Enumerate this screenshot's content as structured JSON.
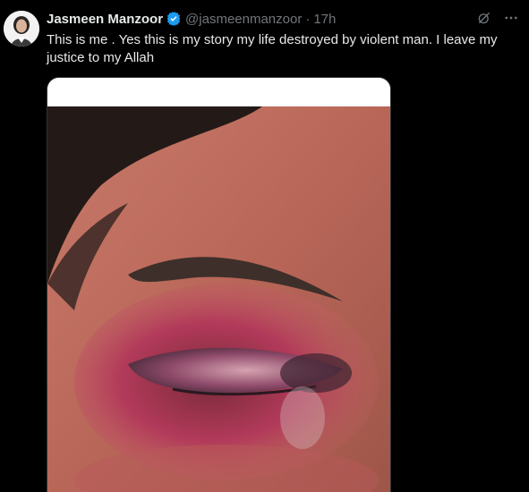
{
  "tweet": {
    "display_name": "Jasmeen Manzoor",
    "handle": "@jasmeenmanzoor",
    "separator": "·",
    "time": "17h",
    "text": "This is me . Yes this is my story my life destroyed by violent man. I leave my justice to my Allah"
  },
  "icons": {
    "verified": "verified-badge-icon",
    "grok": "grok-icon",
    "more": "more-icon"
  },
  "colors": {
    "background": "#000000",
    "text_primary": "#e7e9ea",
    "text_secondary": "#71767b",
    "verified_blue": "#1d9bf0"
  }
}
